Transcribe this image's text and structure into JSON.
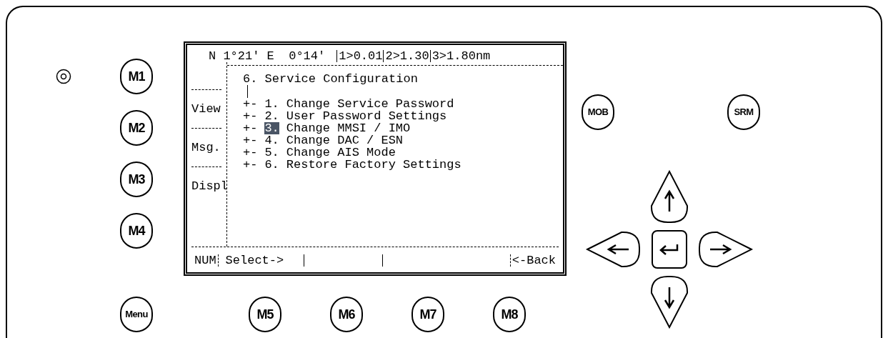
{
  "status_bar": {
    "position": "N 1°21' E  0°14'",
    "ranges": [
      "1>0.01",
      "2>1.30",
      "3>1.80nm"
    ]
  },
  "soft_keys_left": [
    "View",
    "Msg.",
    "Displ"
  ],
  "menu": {
    "title": "6. Service Configuration",
    "items": [
      {
        "prefix": "+-",
        "number": "1.",
        "label": "Change Service Password",
        "selected": false
      },
      {
        "prefix": "+-",
        "number": "2.",
        "label": "User Password Settings",
        "selected": false
      },
      {
        "prefix": "+-",
        "number": "3.",
        "label": "Change MMSI / IMO",
        "selected": true
      },
      {
        "prefix": "+-",
        "number": "4.",
        "label": "Change DAC / ESN",
        "selected": false
      },
      {
        "prefix": "+-",
        "number": "5.",
        "label": "Change AIS Mode",
        "selected": false
      },
      {
        "prefix": "+-",
        "number": "6.",
        "label": "Restore Factory Settings",
        "selected": false
      }
    ]
  },
  "bottom_bar": {
    "mode": "NUM",
    "select": "Select->",
    "back": "<-Back"
  },
  "keys_left": [
    "M1",
    "M2",
    "M3",
    "M4"
  ],
  "menu_key": "Menu",
  "keys_bottom": [
    "M5",
    "M6",
    "M7",
    "M8"
  ],
  "keys_right": [
    "MOB",
    "SRM"
  ]
}
